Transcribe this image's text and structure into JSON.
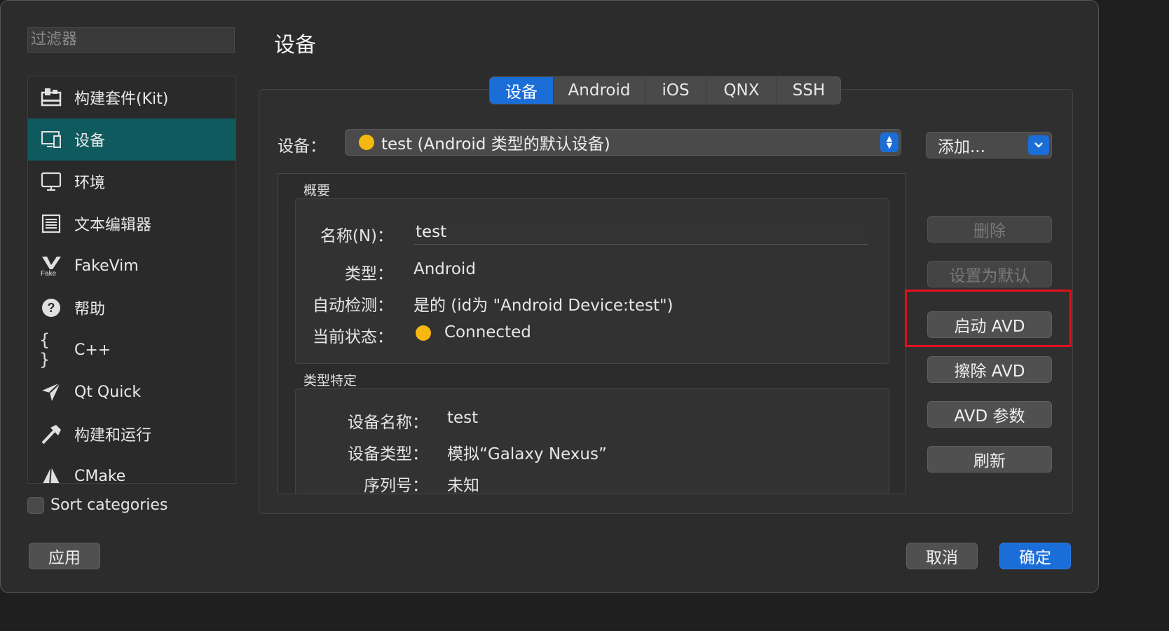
{
  "filter": {
    "placeholder": "过滤器"
  },
  "sidebar": {
    "items": [
      {
        "label": "构建套件(Kit)",
        "icon": "kit-icon"
      },
      {
        "label": "设备",
        "icon": "device-icon",
        "active": true
      },
      {
        "label": "环境",
        "icon": "monitor-icon"
      },
      {
        "label": "文本编辑器",
        "icon": "text-editor-icon"
      },
      {
        "label": "FakeVim",
        "icon": "fakevim-icon"
      },
      {
        "label": "帮助",
        "icon": "help-icon"
      },
      {
        "label": "C++",
        "icon": "braces-icon"
      },
      {
        "label": "Qt Quick",
        "icon": "qtquick-icon"
      },
      {
        "label": "构建和运行",
        "icon": "hammer-icon"
      },
      {
        "label": "CMake",
        "icon": "cmake-icon"
      }
    ],
    "sort_label": "Sort categories"
  },
  "page": {
    "title": "设备"
  },
  "tabs": [
    "设备",
    "Android",
    "iOS",
    "QNX",
    "SSH"
  ],
  "device": {
    "label": "设备：",
    "selected": "test (Android 类型的默认设备)",
    "add_label": "添加..."
  },
  "summary": {
    "title": "概要",
    "name_label": "名称(N)：",
    "name_value": "test",
    "type_label": "类型：",
    "type_value": "Android",
    "auto_label": "自动检测：",
    "auto_value": "是的 (id为 \"Android Device:test\")",
    "status_label": "当前状态：",
    "status_value": "Connected"
  },
  "specific": {
    "title": "类型特定",
    "dev_name_label": "设备名称：",
    "dev_name_value": "test",
    "dev_type_label": "设备类型：",
    "dev_type_value": "模拟“Galaxy Nexus”",
    "serial_label": "序列号：",
    "serial_value": "未知"
  },
  "actions": {
    "delete": "删除",
    "set_default": "设置为默认",
    "start_avd": "启动 AVD",
    "wipe_avd": "擦除 AVD",
    "avd_params": "AVD 参数",
    "refresh": "刷新"
  },
  "footer": {
    "apply": "应用",
    "cancel": "取消",
    "ok": "确定"
  },
  "colors": {
    "accent": "#1b6ed8",
    "selection": "#0f5a5e",
    "status_dot": "#f6b70f",
    "highlight": "#e0111c"
  }
}
